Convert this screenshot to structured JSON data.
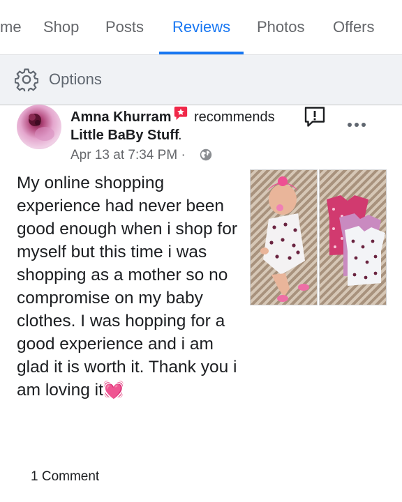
{
  "tabs": [
    {
      "label": "Home",
      "visible_label": "me"
    },
    {
      "label": "Shop"
    },
    {
      "label": "Posts"
    },
    {
      "label": "Reviews",
      "active": true
    },
    {
      "label": "Photos"
    },
    {
      "label": "Offers"
    }
  ],
  "options": {
    "label": "Options",
    "icon": "gear-icon"
  },
  "post": {
    "author": "Amna Khurram",
    "action": "recommends",
    "page": "Little BaBy Stuff",
    "page_suffix": ".",
    "timestamp": "Apr 13 at 7:34 PM",
    "separator": "·",
    "privacy_icon": "globe-icon",
    "text": "My online shopping experience had never been good enough when i shop for myself but this time i was shopping as a mother so no compromise on my baby clothes. I was hopping for a good experience and i am glad it is worth it. Thank you i am loving it",
    "emoji": "💓",
    "photos": [
      "baby-in-romper-photo",
      "baby-clothes-photo"
    ]
  },
  "footer": {
    "comments": "1 Comment"
  },
  "colors": {
    "accent": "#1877f2",
    "badge": "#f02849",
    "muted": "#65676b",
    "options_bg": "#f0f2f5"
  }
}
